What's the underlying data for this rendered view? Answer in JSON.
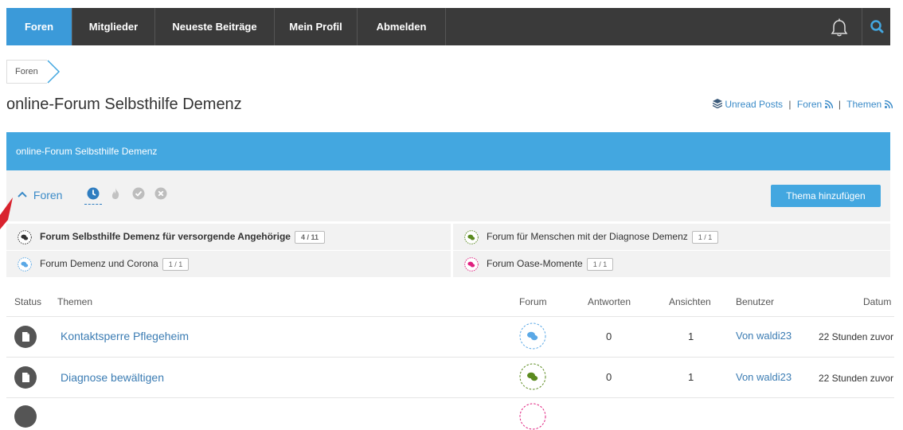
{
  "nav": {
    "tabs": [
      "Foren",
      "Mitglieder",
      "Neueste Beiträge",
      "Mein Profil",
      "Abmelden"
    ],
    "active": 0
  },
  "breadcrumb": {
    "label": "Foren"
  },
  "page": {
    "title": "online-Forum Selbsthilfe Demenz"
  },
  "toplinks": {
    "unread": "Unread Posts",
    "foren": "Foren",
    "themen": "Themen",
    "sep": "|"
  },
  "header": {
    "title": "online-Forum Selbsthilfe Demenz"
  },
  "toolbar": {
    "toggle_label": "Foren",
    "add_button": "Thema hinzufügen"
  },
  "forums": [
    {
      "name": "Forum Selbsthilfe Demenz für versorgende Angehörige",
      "badge": "4 / 11",
      "color": "#333333"
    },
    {
      "name": "Forum für Menschen mit der Diagnose Demenz",
      "badge": "1 / 1",
      "color": "#5a8a1e"
    },
    {
      "name": "Forum Demenz und Corona",
      "badge": "1 / 1",
      "color": "#5aa8e6"
    },
    {
      "name": "Forum Oase-Momente",
      "badge": "1 / 1",
      "color": "#e0207f"
    }
  ],
  "table": {
    "headers": {
      "status": "Status",
      "themen": "Themen",
      "forum": "Forum",
      "antworten": "Antworten",
      "ansichten": "Ansichten",
      "benutzer": "Benutzer",
      "datum": "Datum"
    },
    "rows": [
      {
        "title": "Kontaktsperre Pflegeheim",
        "forum_color": "#5aa8e6",
        "antworten": "0",
        "ansichten": "1",
        "user": "Von waldi23",
        "date": "22 Stunden zuvor"
      },
      {
        "title": "Diagnose bewältigen",
        "forum_color": "#5a8a1e",
        "antworten": "0",
        "ansichten": "1",
        "user": "Von waldi23",
        "date": "22 Stunden zuvor"
      }
    ]
  },
  "colors": {
    "accent": "#43a7e0",
    "nav_bg": "#3a3a3a",
    "link": "#3b7cb3",
    "annotation": "#d9232e"
  },
  "icons": [
    "bell-icon",
    "search-icon",
    "chevron-up-icon",
    "clock-icon",
    "fire-icon",
    "check-circle-icon",
    "close-circle-icon",
    "rss-icon",
    "layers-icon",
    "chat-bubbles-icon",
    "document-icon"
  ]
}
